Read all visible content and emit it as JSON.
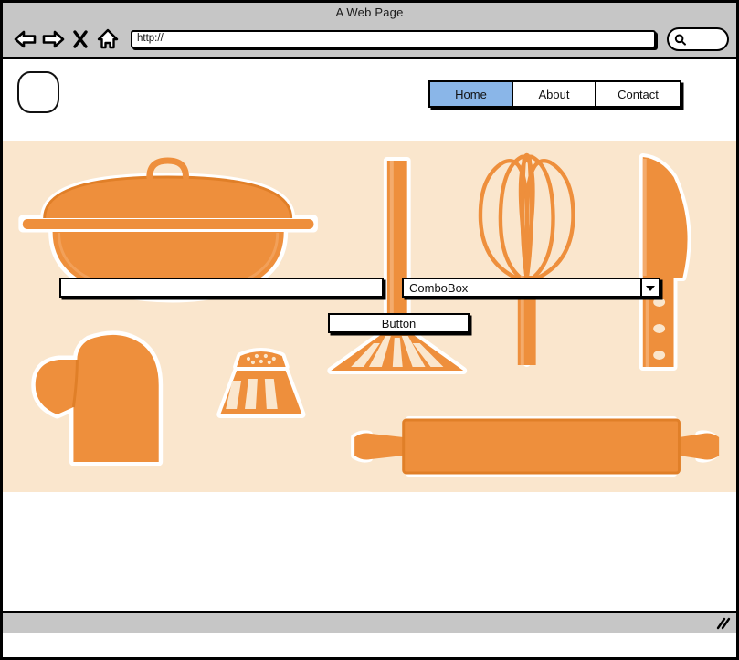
{
  "window": {
    "title": "A Web Page"
  },
  "toolbar": {
    "back_icon": "back-arrow-icon",
    "forward_icon": "forward-arrow-icon",
    "stop_icon": "close-x-icon",
    "home_icon": "home-icon",
    "url_value": "http://",
    "url_placeholder": "http://",
    "search_value": "",
    "search_placeholder": "",
    "search_icon": "magnifier-icon"
  },
  "site": {
    "logo_name": "logo-placeholder",
    "nav": [
      {
        "label": "Home",
        "selected": true
      },
      {
        "label": "About",
        "selected": false
      },
      {
        "label": "Contact",
        "selected": false
      }
    ]
  },
  "hero": {
    "name": "kitchen-utensils-banner",
    "background_color": "#fae6cd",
    "accent_color": "#ee8f3c",
    "items": [
      "cooking-pot-with-lid",
      "oven-mitt",
      "salt-shaker",
      "potato-masher",
      "whisk",
      "chef-knife",
      "rolling-pin"
    ]
  },
  "widgets": {
    "textfield_value": "",
    "textfield_placeholder": "",
    "combobox_value": "ComboBox",
    "combobox_arrow_icon": "chevron-down-icon",
    "button_label": "Button"
  },
  "status": {
    "text": "",
    "grip_icon": "resize-grip-icon"
  },
  "colors": {
    "chrome": "#c6c6c6",
    "selected_tab": "#8ab6e8",
    "hero_bg": "#fae6cd",
    "hero_accent": "#ee8f3c",
    "outline": "#000000"
  }
}
